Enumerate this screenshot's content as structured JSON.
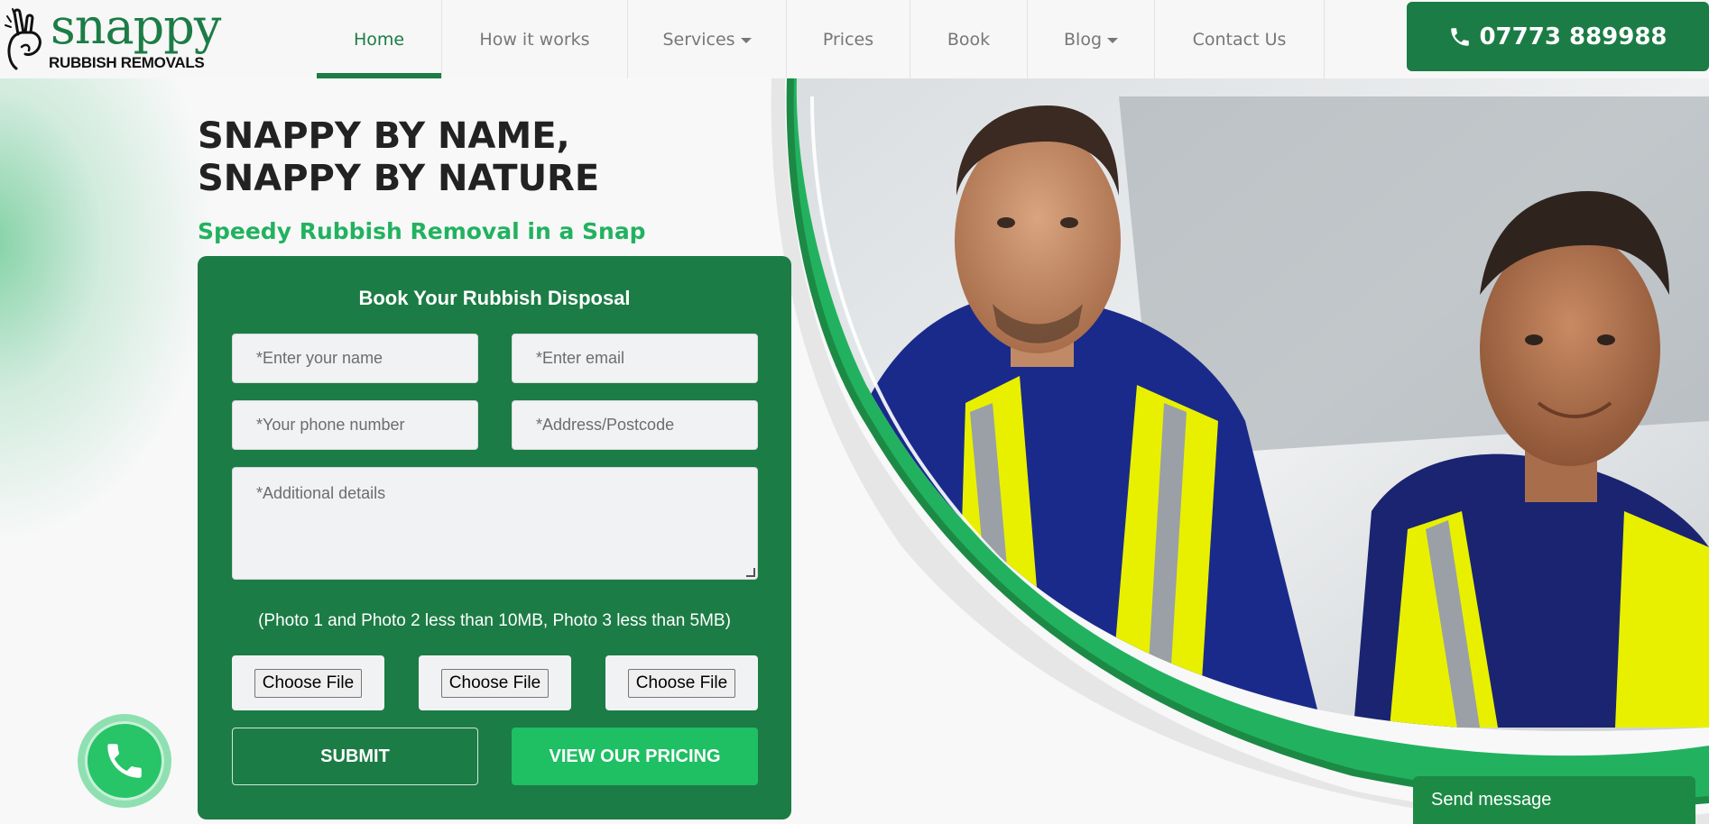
{
  "brand": {
    "name": "snappy",
    "tagline": "RUBBISH REMOVALS"
  },
  "nav": {
    "items": [
      {
        "label": "Home",
        "active": true,
        "dropdown": false
      },
      {
        "label": "How it works",
        "active": false,
        "dropdown": false
      },
      {
        "label": "Services",
        "active": false,
        "dropdown": true
      },
      {
        "label": "Prices",
        "active": false,
        "dropdown": false
      },
      {
        "label": "Book",
        "active": false,
        "dropdown": false
      },
      {
        "label": "Blog",
        "active": false,
        "dropdown": true
      },
      {
        "label": "Contact Us",
        "active": false,
        "dropdown": false
      }
    ],
    "phone": "07773 889988"
  },
  "hero": {
    "headline_line1": "SNAPPY BY NAME,",
    "headline_line2": "SNAPPY BY NATURE",
    "subheadline": "Speedy Rubbish Removal in a Snap"
  },
  "form": {
    "title": "Book Your Rubbish Disposal",
    "name_placeholder": "*Enter your name",
    "email_placeholder": "*Enter email",
    "phone_placeholder": "*Your phone number",
    "address_placeholder": "*Address/Postcode",
    "details_placeholder": "*Additional details",
    "photo_note": "(Photo 1 and Photo 2 less than 10MB, Photo 3 less than 5MB)",
    "file_button_label": "Choose File",
    "submit_label": "SUBMIT",
    "pricing_label": "VIEW OUR PRICING"
  },
  "chat": {
    "send_message_label": "Send message"
  },
  "colors": {
    "brand_green": "#1c7c45",
    "accent_green": "#22b25f",
    "button_green": "#1fbf64"
  },
  "icons": {
    "phone": "phone-icon",
    "call_fab": "whatsapp-phone-icon"
  }
}
